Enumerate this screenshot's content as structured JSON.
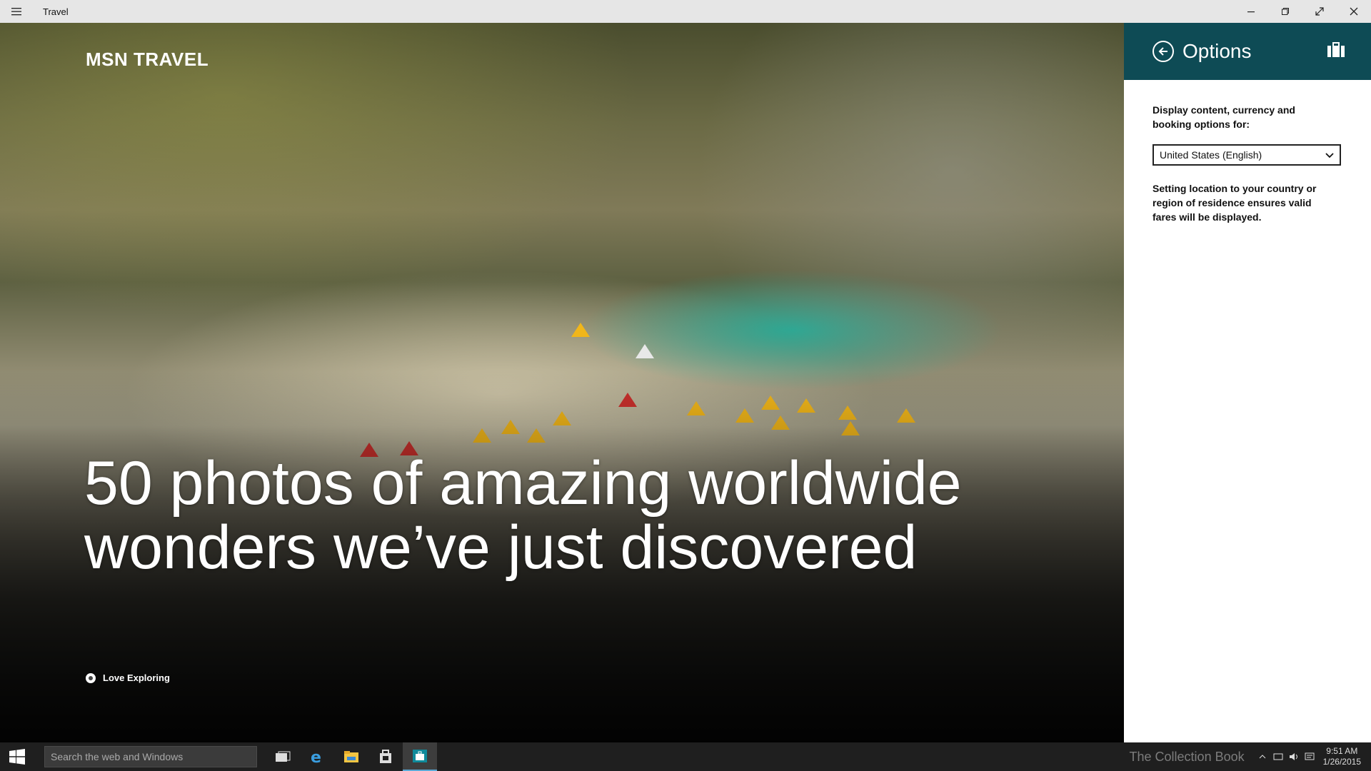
{
  "window": {
    "title": "Travel",
    "icons": {
      "menu": "hamburger-menu-icon",
      "minimize": "minimize-icon",
      "restore": "restore-icon",
      "fullscreen": "fullscreen-icon",
      "close": "close-icon"
    }
  },
  "hero": {
    "brand": "MSN TRAVEL",
    "headline": "50 photos of amazing worldwide wonders we’ve just discovered",
    "source": "Love Exploring"
  },
  "options_pane": {
    "title": "Options",
    "back_icon": "back-arrow-icon",
    "bag_icon": "suitcase-icon",
    "description": "Display content, currency and booking options for:",
    "location": {
      "selected": "United States (English)"
    },
    "note": "Setting location to your country or region of residence ensures valid fares will be displayed.",
    "header_color": "#0e4b55"
  },
  "taskbar": {
    "search_placeholder": "Search the web and Windows",
    "apps": [
      "task-view-icon",
      "internet-explorer-icon",
      "file-explorer-icon",
      "store-icon",
      "travel-app-icon"
    ],
    "watermark": "The Collection Book",
    "time": "9:51 AM",
    "date": "1/26/2015"
  }
}
